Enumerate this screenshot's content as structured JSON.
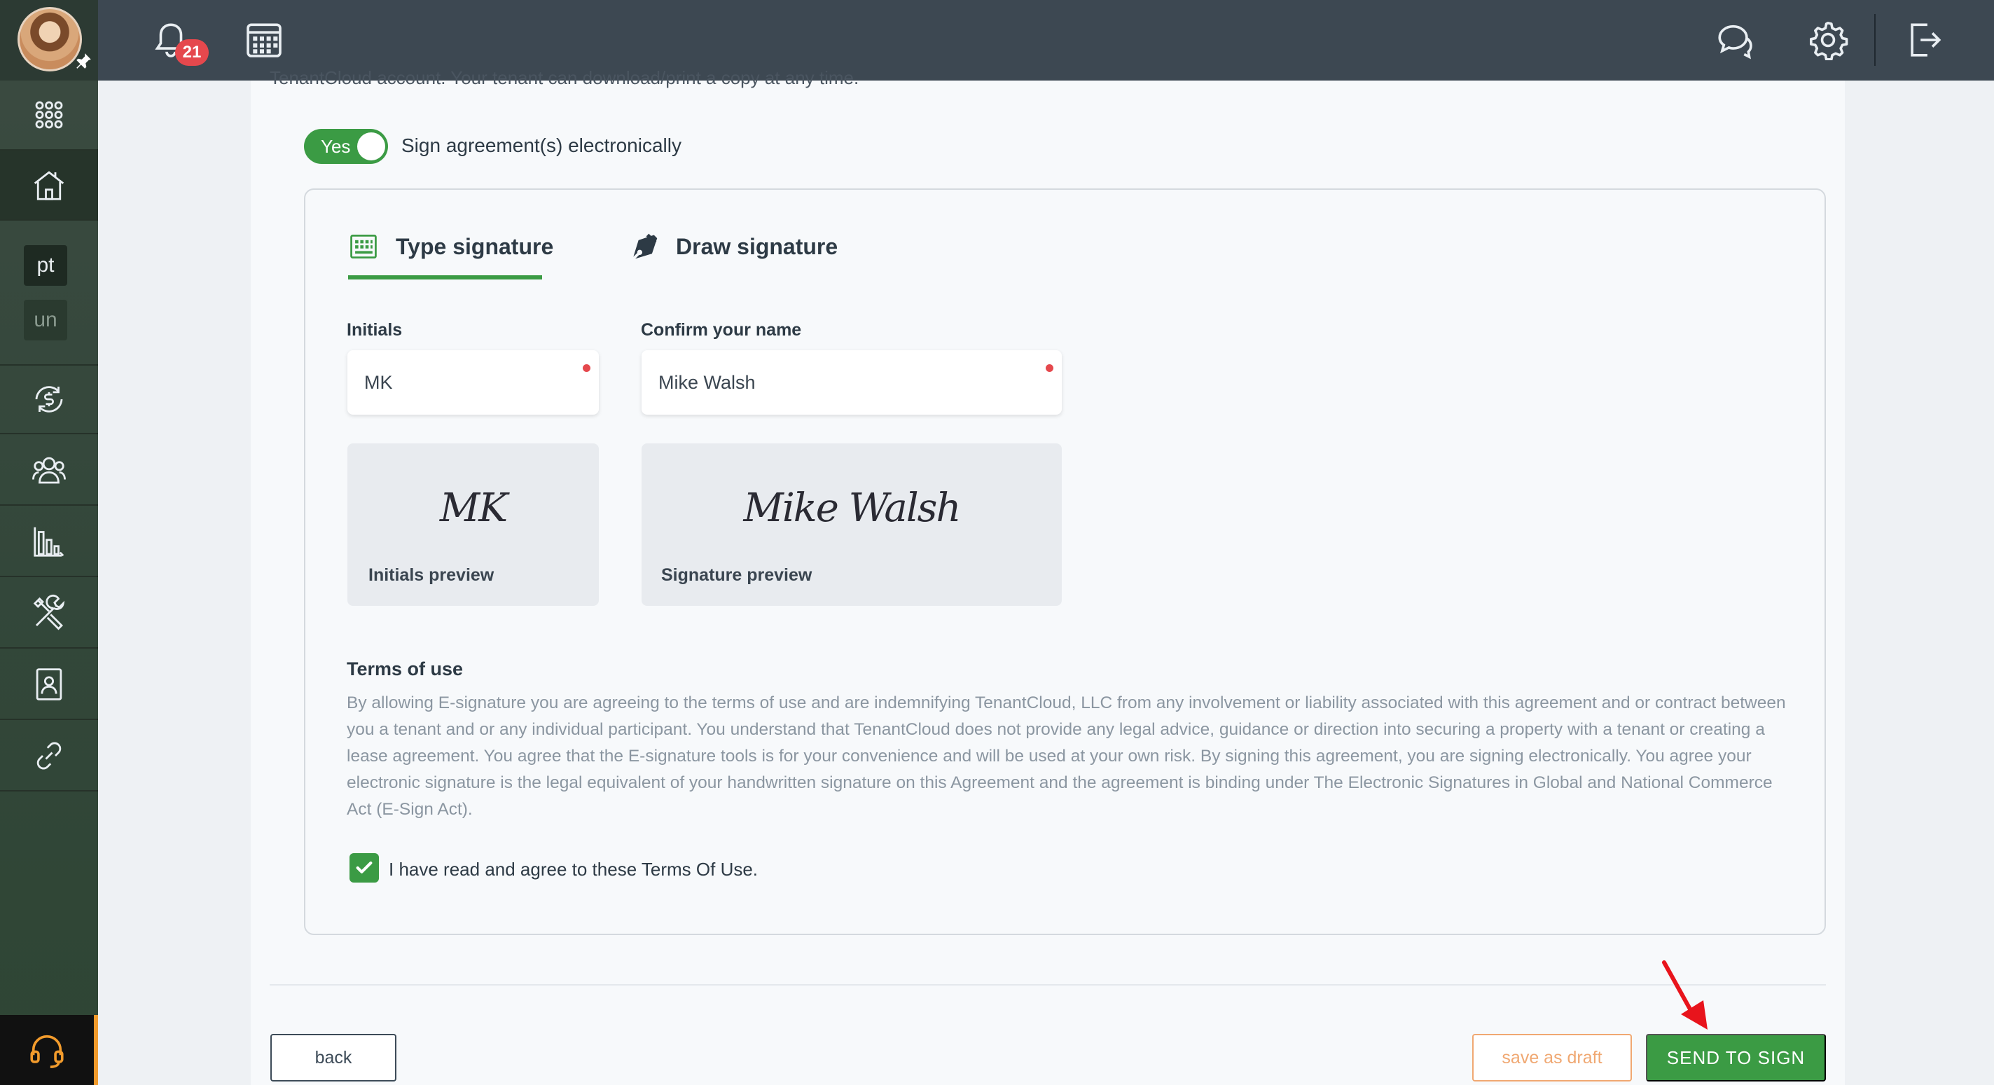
{
  "topbar": {
    "notifications_count": "21",
    "icons": [
      "bell-icon",
      "calendar-icon",
      "chat-icon",
      "gear-icon",
      "logout-icon"
    ]
  },
  "sidebar": {
    "items": [
      {
        "icon": "apps-grid-icon"
      },
      {
        "icon": "properties-house-icon"
      },
      {
        "label": "pt"
      },
      {
        "label": "un"
      },
      {
        "icon": "accounting-money-icon"
      },
      {
        "icon": "people-icon"
      },
      {
        "icon": "reports-chart-icon"
      },
      {
        "icon": "maintenance-tools-icon"
      },
      {
        "icon": "applications-document-icon"
      },
      {
        "icon": "link-icon"
      }
    ],
    "support_icon": "headset-icon",
    "accent": "#f29b2c"
  },
  "content": {
    "cut_off_text": "TenantCloud account. Your tenant can download/print a copy at any time.",
    "toggle": {
      "label": "Yes",
      "text": "Sign agreement(s) electronically",
      "on": true
    },
    "tabs": {
      "type_signature": "Type signature",
      "draw_signature": "Draw signature"
    },
    "initials": {
      "label": "Initials",
      "value": "MK"
    },
    "confirm_name": {
      "label": "Confirm your name",
      "value": "Mike Walsh"
    },
    "initials_preview": {
      "signature": "MK",
      "label": "Initials preview"
    },
    "signature_preview": {
      "signature": "Mike Walsh",
      "label": "Signature preview"
    },
    "terms": {
      "title": "Terms of use",
      "body": "By allowing E-signature you are agreeing to the terms of use and are indemnifying TenantCloud, LLC from any involvement or liability associated with this agreement and or contract between you a tenant and or any individual participant. You understand that TenantCloud does not provide any legal advice, guidance or direction into securing a property with a tenant or creating a lease agreement. You agree that the E-signature tools is for your convenience and will be used at your own risk. By signing this agreement, you are signing electronically. You agree your electronic signature is the legal equivalent of your handwritten signature on this Agreement and the agreement is binding under The Electronic Signatures in Global and National Commerce Act (E-Sign Act).",
      "agree_label": "I have read and agree to these Terms Of Use.",
      "agreed": true
    }
  },
  "footer": {
    "back_label": "back",
    "draft_label": "save as draft",
    "send_label": "SEND TO SIGN"
  },
  "colors": {
    "primary_green": "#3b9b44",
    "topbar": "#3d4852",
    "required_dot": "#e5484d",
    "draft_orange": "#f0a872",
    "annotation_arrow": "#e8141c"
  }
}
